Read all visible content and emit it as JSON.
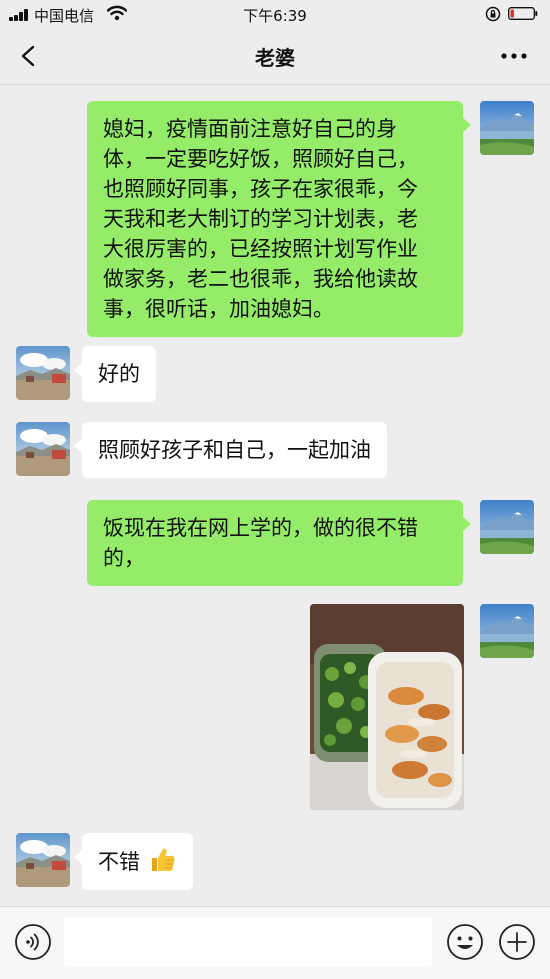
{
  "status_bar": {
    "carrier": "中国电信",
    "time": "下午6:39"
  },
  "chat": {
    "title": "老婆"
  },
  "messages": [
    {
      "side": "right",
      "lines": [
        "媳妇，疫情面前注意好自己的身",
        "体，一定要吃好饭，照顾好自己，",
        "也照顾好同事，孩子在家很乖，今",
        "天我和老大制订的学习计划表，老",
        "大很厉害的，已经按照计划写作业",
        "做家务，老二也很乖，我给他读故",
        "事，很听话，加油媳妇。"
      ]
    },
    {
      "side": "left",
      "text": "好的"
    },
    {
      "side": "left",
      "text": "照顾好孩子和自己，一起加油"
    },
    {
      "side": "right",
      "lines": [
        "饭现在我在网上学的，做的很不错",
        "的，"
      ]
    },
    {
      "side": "right",
      "type": "image",
      "icon": "food-photo"
    },
    {
      "side": "left",
      "text": "不错",
      "emoji": "thumbs-up-icon"
    }
  ],
  "input": {
    "placeholder": ""
  },
  "colors": {
    "background": "#ededed",
    "self_bubble": "#95ec69",
    "other_bubble": "#ffffff"
  }
}
